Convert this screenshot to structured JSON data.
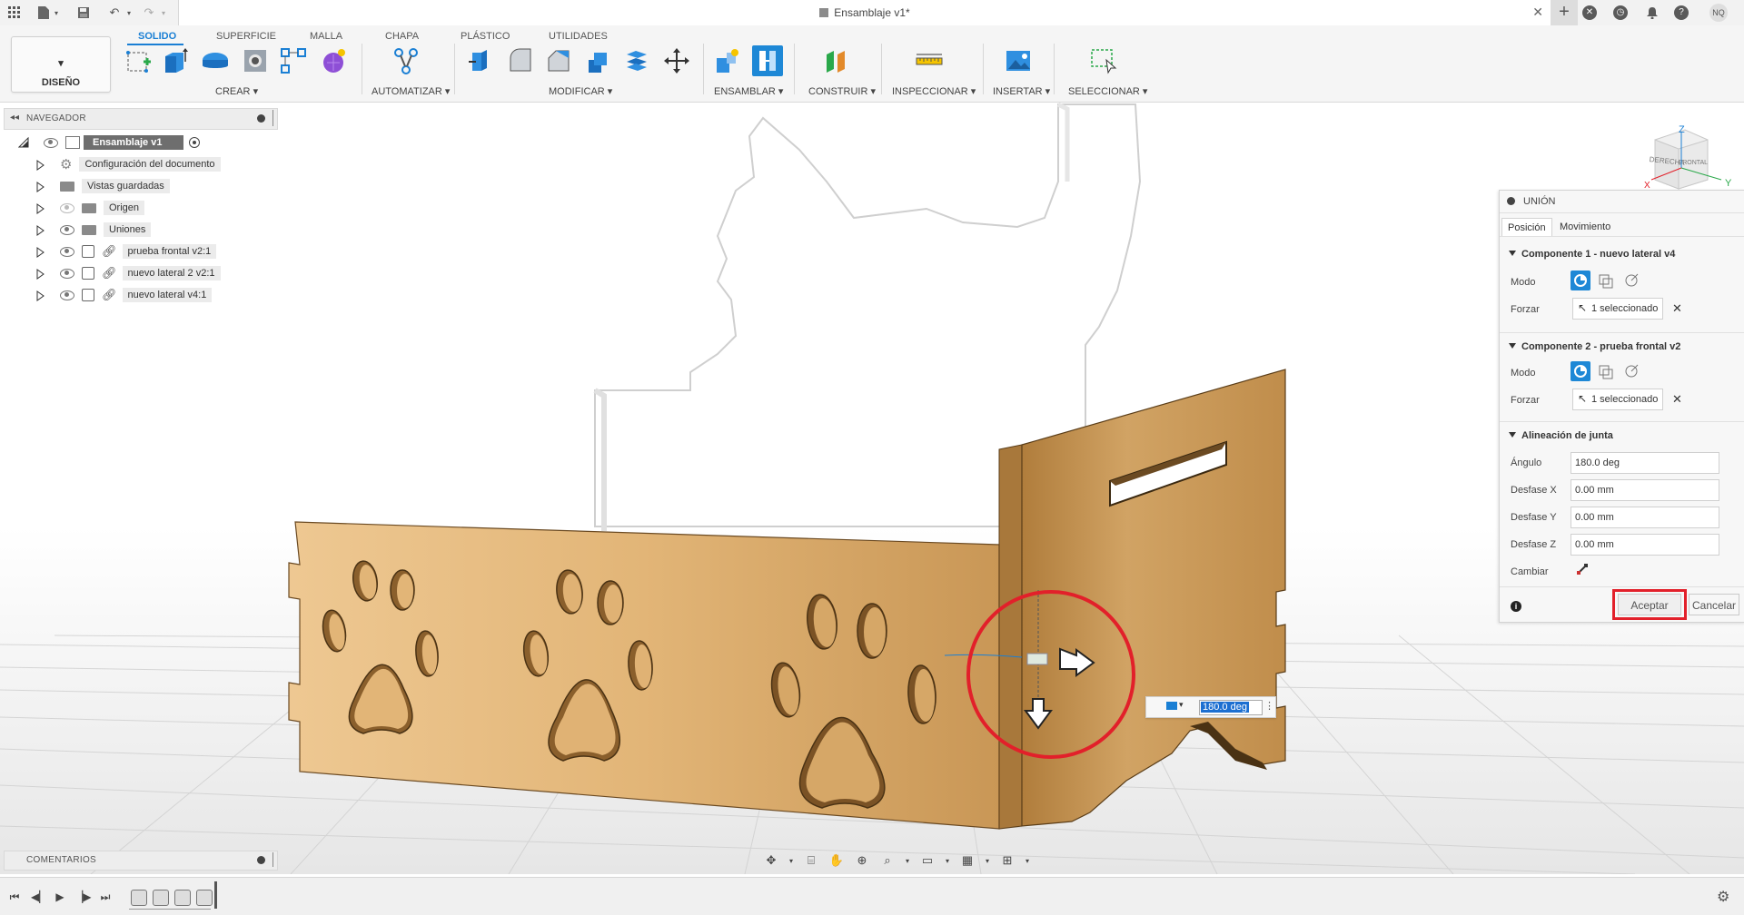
{
  "window": {
    "title": "Ensamblaje v1*",
    "user_initials": "NQ"
  },
  "toolbar": {
    "workspace": "DISEÑO",
    "tabs": [
      "SOLIDO",
      "SUPERFICIE",
      "MALLA",
      "CHAPA",
      "PLÁSTICO",
      "UTILIDADES"
    ],
    "active_tab": "SOLIDO",
    "groups": {
      "crear": "CREAR",
      "automatizar": "AUTOMATIZAR",
      "modificar": "MODIFICAR",
      "ensamblar": "ENSAMBLAR",
      "construir": "CONSTRUIR",
      "inspeccionar": "INSPECCIONAR",
      "insertar": "INSERTAR",
      "seleccionar": "SELECCIONAR"
    }
  },
  "browser": {
    "title": "NAVEGADOR",
    "root": "Ensamblaje v1",
    "items": [
      {
        "label": "Configuración del documento",
        "type": "settings"
      },
      {
        "label": "Vistas guardadas",
        "type": "folder"
      },
      {
        "label": "Origen",
        "type": "folder"
      },
      {
        "label": "Uniones",
        "type": "folder"
      },
      {
        "label": "prueba frontal v2:1",
        "type": "component"
      },
      {
        "label": "nuevo lateral 2 v2:1",
        "type": "component"
      },
      {
        "label": "nuevo lateral v4:1",
        "type": "component"
      }
    ],
    "comments": "COMENTARIOS"
  },
  "viewcube": {
    "face_right": "DERECHA",
    "face_front": "FRONTAL",
    "axis_x": "X",
    "axis_y": "Y",
    "axis_z": "Z"
  },
  "dialog": {
    "title": "UNIÓN",
    "tabs": [
      "Posición",
      "Movimiento"
    ],
    "active_tab": "Posición",
    "component1": {
      "title": "Componente 1 - nuevo lateral v4",
      "mode_label": "Modo",
      "snap_label": "Forzar",
      "snap_value": "1 seleccionado"
    },
    "component2": {
      "title": "Componente 2 - prueba frontal v2",
      "mode_label": "Modo",
      "snap_label": "Forzar",
      "snap_value": "1 seleccionado"
    },
    "alignment": {
      "title": "Alineación de junta",
      "angle_label": "Ángulo",
      "angle_value": "180.0 deg",
      "offset_x_label": "Desfase X",
      "offset_x_value": "0.00 mm",
      "offset_y_label": "Desfase Y",
      "offset_y_value": "0.00 mm",
      "offset_z_label": "Desfase Z",
      "offset_z_value": "0.00 mm",
      "flip_label": "Cambiar"
    },
    "accept": "Aceptar",
    "cancel": "Cancelar"
  },
  "canvas_input": {
    "angle_value": "180.0 deg"
  },
  "colors": {
    "accent": "#1a7fd4",
    "highlight_red": "#e2202a",
    "wood": "#d9aa6b"
  }
}
